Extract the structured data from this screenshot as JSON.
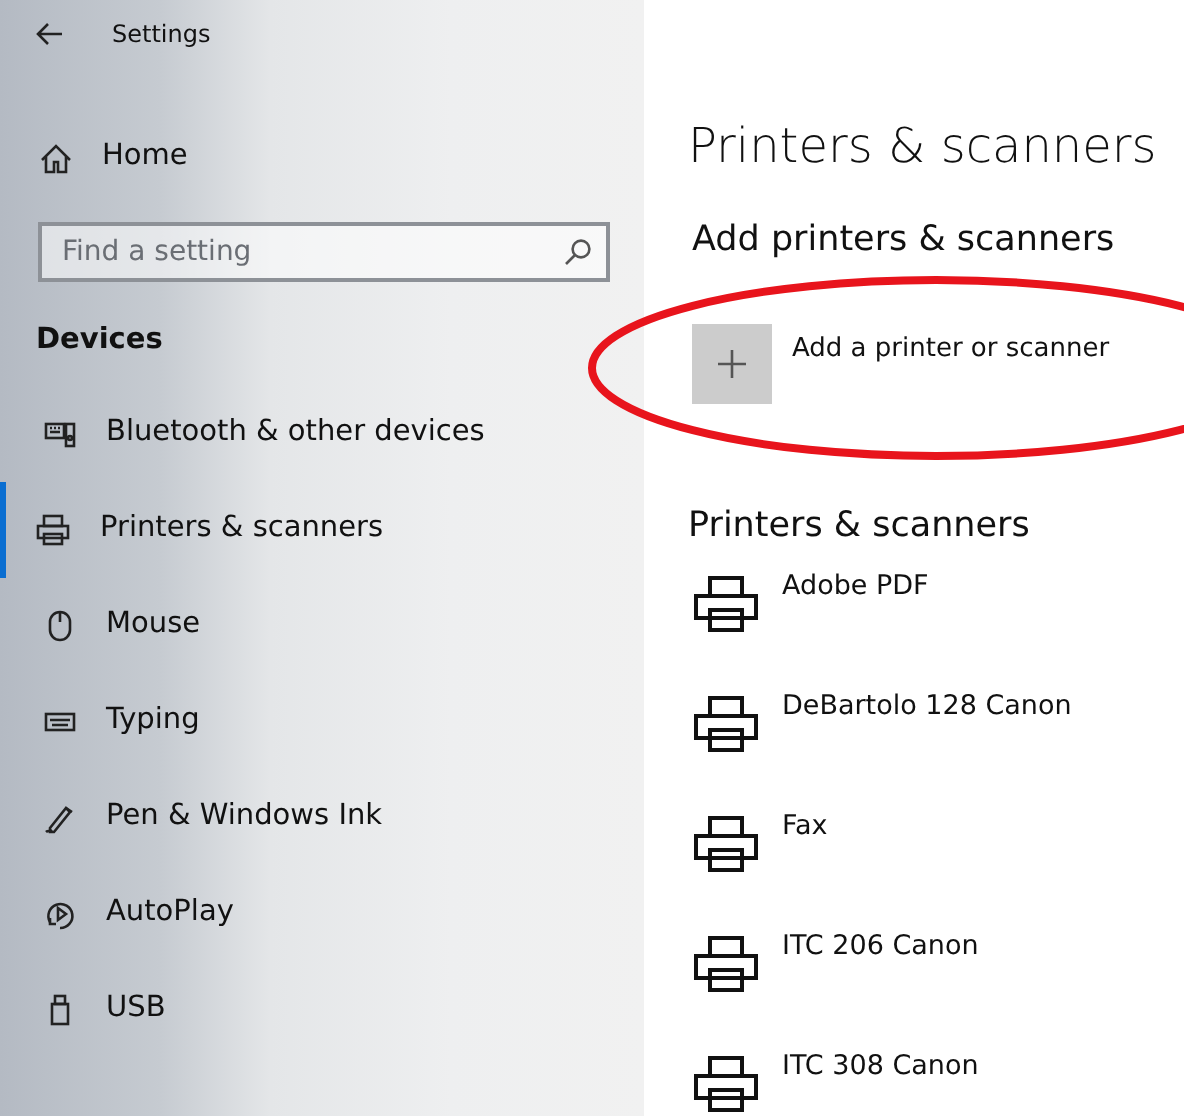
{
  "window": {
    "title": "Settings"
  },
  "sidebar": {
    "home": "Home",
    "search": {
      "placeholder": "Find a setting"
    },
    "section": "Devices",
    "items": [
      {
        "label": "Bluetooth & other devices",
        "kind": "bluetooth",
        "selected": false
      },
      {
        "label": "Printers & scanners",
        "kind": "printer",
        "selected": true
      },
      {
        "label": "Mouse",
        "kind": "mouse",
        "selected": false
      },
      {
        "label": "Typing",
        "kind": "keyboard",
        "selected": false
      },
      {
        "label": "Pen & Windows Ink",
        "kind": "pen",
        "selected": false
      },
      {
        "label": "AutoPlay",
        "kind": "autoplay",
        "selected": false
      },
      {
        "label": "USB",
        "kind": "usb",
        "selected": false
      }
    ]
  },
  "page": {
    "title": "Printers & scanners",
    "add_section": "Add printers & scanners",
    "add_button": "Add a printer or scanner",
    "list_heading": "Printers & scanners",
    "printers": [
      {
        "name": "Adobe PDF"
      },
      {
        "name": "DeBartolo 128 Canon"
      },
      {
        "name": "Fax"
      },
      {
        "name": "ITC 206 Canon"
      },
      {
        "name": "ITC 308 Canon"
      }
    ]
  },
  "annotation": {
    "kind": "ellipse"
  }
}
